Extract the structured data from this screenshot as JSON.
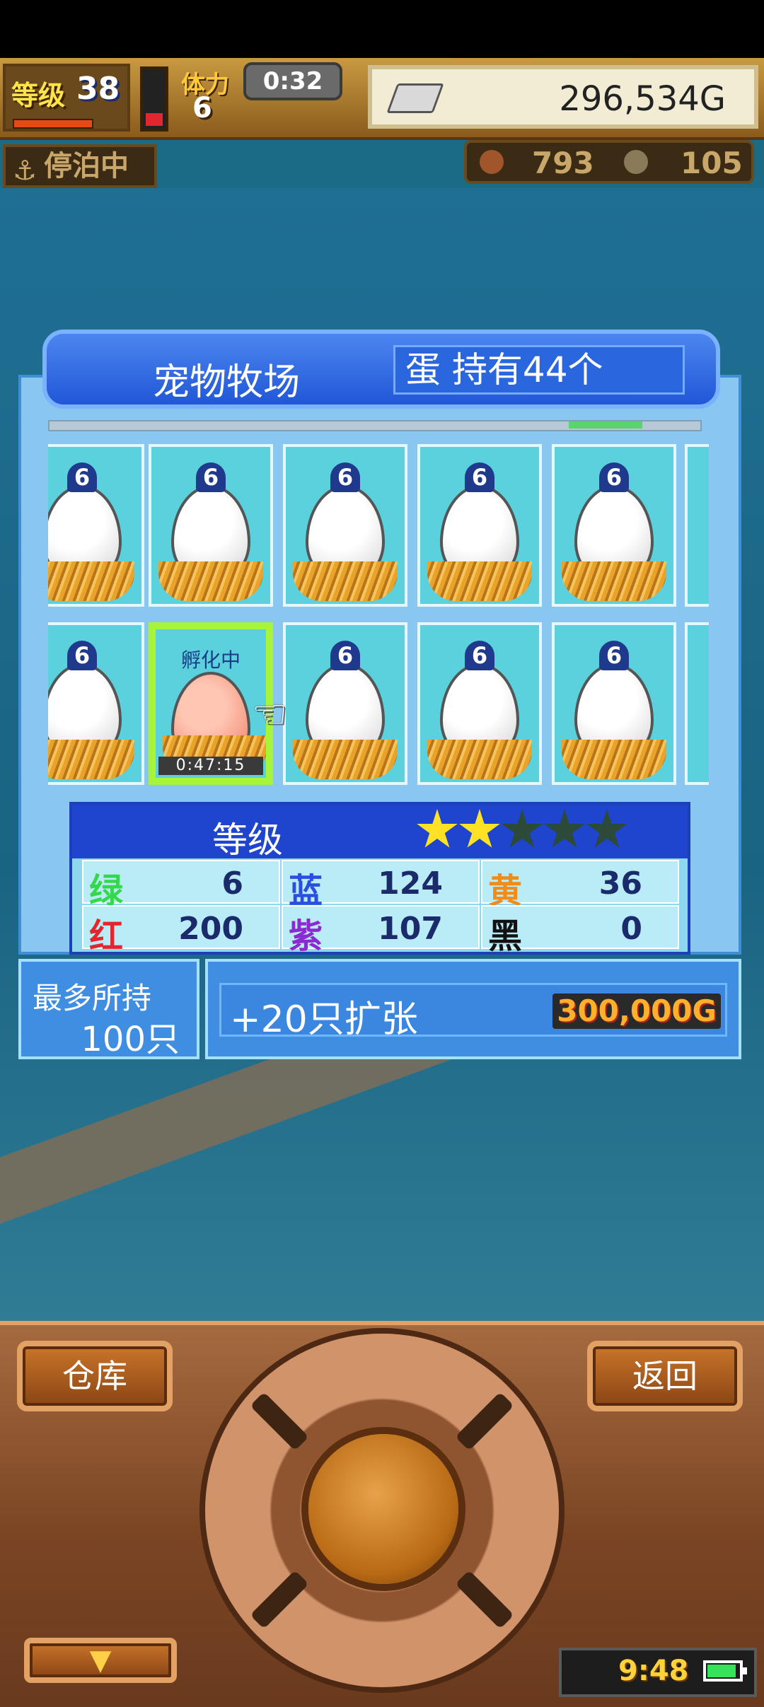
{
  "hud": {
    "level_label": "等级",
    "level_value": "38",
    "stamina_label": "体力",
    "stamina_value": "6",
    "timer": "0:32",
    "money": "296,534G"
  },
  "status_row": {
    "docked_label": "停泊中",
    "resource1": "793",
    "resource2": "105"
  },
  "panel": {
    "title": "宠物牧场",
    "egg_count": "蛋 持有44个",
    "rows": [
      {
        "cells": [
          {
            "badge": "6"
          },
          {
            "badge": "6"
          },
          {
            "badge": "6"
          },
          {
            "badge": "6"
          },
          {
            "badge": "6"
          }
        ]
      },
      {
        "cells": [
          {
            "badge": "6"
          },
          {
            "badge": "",
            "status": "孵化中",
            "timer": "0:47:15"
          },
          {
            "badge": "6"
          },
          {
            "badge": "6"
          },
          {
            "badge": "6"
          }
        ]
      }
    ]
  },
  "stats": {
    "grade_label": "等级",
    "stars_filled": 2,
    "stars_total": 5,
    "items": [
      {
        "name": "绿",
        "value": "6",
        "color": "#35d84c"
      },
      {
        "name": "蓝",
        "value": "124",
        "color": "#2a4fe0"
      },
      {
        "name": "黄",
        "value": "36",
        "color": "#f08c1a"
      },
      {
        "name": "红",
        "value": "200",
        "color": "#e5252b"
      },
      {
        "name": "紫",
        "value": "107",
        "color": "#8b2ad0"
      },
      {
        "name": "黑",
        "value": "0",
        "color": "#111111"
      }
    ]
  },
  "capacity": {
    "max_label": "最多所持",
    "max_value": "100只",
    "expand_label": "+20只扩张",
    "expand_price": "300,000G"
  },
  "controls": {
    "warehouse": "仓库",
    "back": "返回",
    "down_arrow": "▼"
  },
  "system": {
    "clock": "9:48"
  }
}
